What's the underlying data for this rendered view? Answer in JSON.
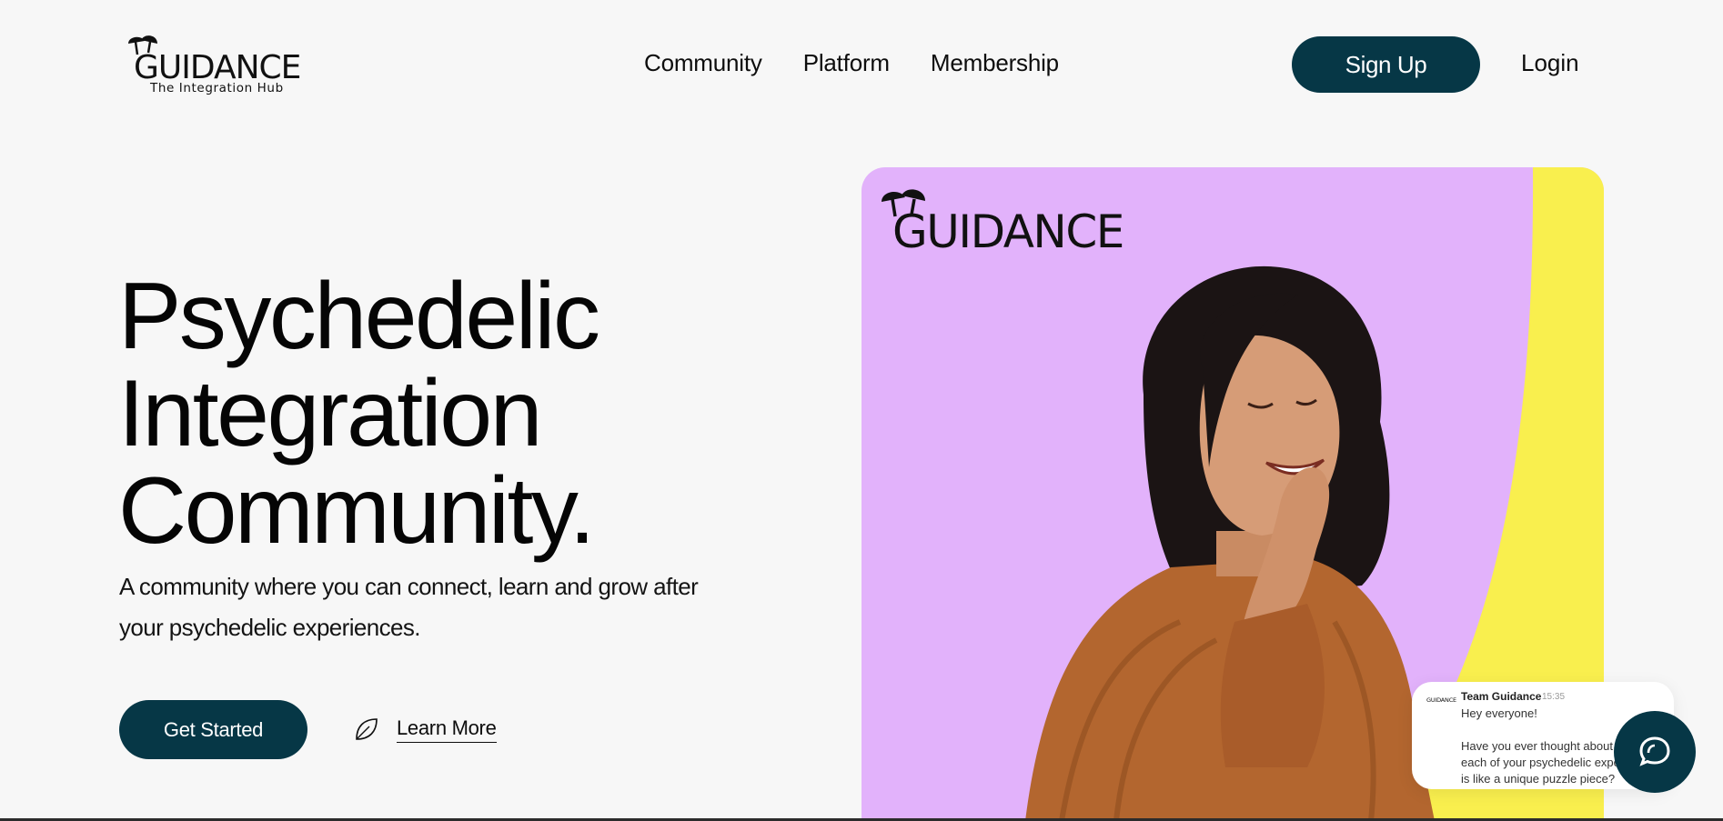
{
  "header": {
    "logo_text": "GUIDANCE",
    "logo_tagline": "The Integration Hub",
    "nav": [
      {
        "label": "Community"
      },
      {
        "label": "Platform"
      },
      {
        "label": "Membership"
      }
    ],
    "signup_label": "Sign Up",
    "login_label": "Login"
  },
  "hero": {
    "headline_lines": [
      "Psychedelic",
      "Integration",
      "Community."
    ],
    "subtitle": "A community where you can connect, learn and grow after your psychedelic experiences.",
    "get_started_label": "Get Started",
    "learn_more_label": "Learn More",
    "card_logo_text": "GUIDANCE"
  },
  "chat": {
    "avatar_text": "GUIDANCE",
    "sender": "Team Guidance",
    "time": "15:35",
    "message": "Hey everyone!\n\nHave you ever thought about\neach of your psychedelic expe\nis like a unique puzzle piece?"
  },
  "colors": {
    "primary": "#063746",
    "card_purple": "#e2b2fb",
    "card_yellow": "#f9ef4e",
    "background": "#f7f7f7"
  },
  "icons": {
    "logo": "mushroom-icon",
    "learn_more": "leaf-icon",
    "chat_button": "chat-bubbles-icon"
  }
}
